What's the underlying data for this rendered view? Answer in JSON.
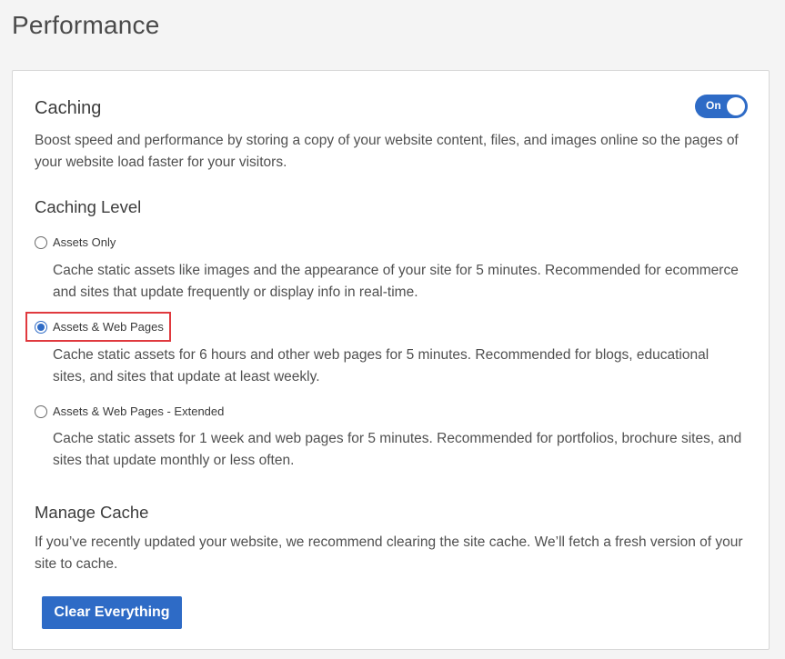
{
  "page": {
    "title": "Performance"
  },
  "caching": {
    "title": "Caching",
    "toggle_label": "On",
    "toggle_on": true,
    "description": "Boost speed and performance by storing a copy of your website content, files, and images online so the pages of your website load faster for your visitors."
  },
  "caching_level": {
    "title": "Caching Level",
    "options": [
      {
        "label": "Assets Only",
        "description": "Cache static assets like images and the appearance of your site for 5 minutes. Recommended for ecommerce and sites that update frequently or display info in real-time.",
        "selected": false
      },
      {
        "label": "Assets & Web Pages",
        "description": "Cache static assets for 6 hours and other web pages for 5 minutes. Recommended for blogs, educational sites, and sites that update at least weekly.",
        "selected": true
      },
      {
        "label": "Assets & Web Pages - Extended",
        "description": "Cache static assets for 1 week and web pages for 5 minutes. Recommended for portfolios, brochure sites, and sites that update monthly or less often.",
        "selected": false
      }
    ]
  },
  "manage_cache": {
    "title": "Manage Cache",
    "description": "If you’ve recently updated your website, we recommend clearing the site cache. We’ll fetch a fresh version of your site to cache.",
    "button_label": "Clear Everything"
  },
  "colors": {
    "accent": "#2e6bc6",
    "highlight": "#e0393e",
    "background": "#f4f4f4"
  }
}
